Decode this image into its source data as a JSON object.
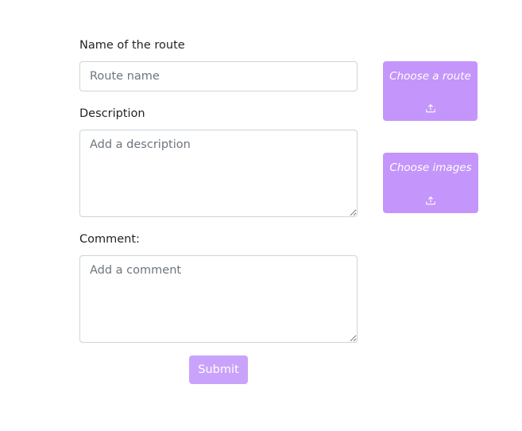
{
  "form": {
    "route_name": {
      "label": "Name of the route",
      "placeholder": "Route name",
      "value": ""
    },
    "description": {
      "label": "Description",
      "placeholder": "Add a description",
      "value": ""
    },
    "comment": {
      "label": "Comment:",
      "placeholder": "Add a comment",
      "value": ""
    },
    "submit_label": "Submit"
  },
  "uploads": {
    "route": {
      "label": "Choose a route",
      "icon": "upload-icon"
    },
    "images": {
      "label": "Choose images",
      "icon": "upload-icon"
    }
  },
  "colors": {
    "accent": "#c495fb",
    "submit": "#c9a3fb",
    "input_border": "#ced4da",
    "placeholder": "#6c757d"
  }
}
